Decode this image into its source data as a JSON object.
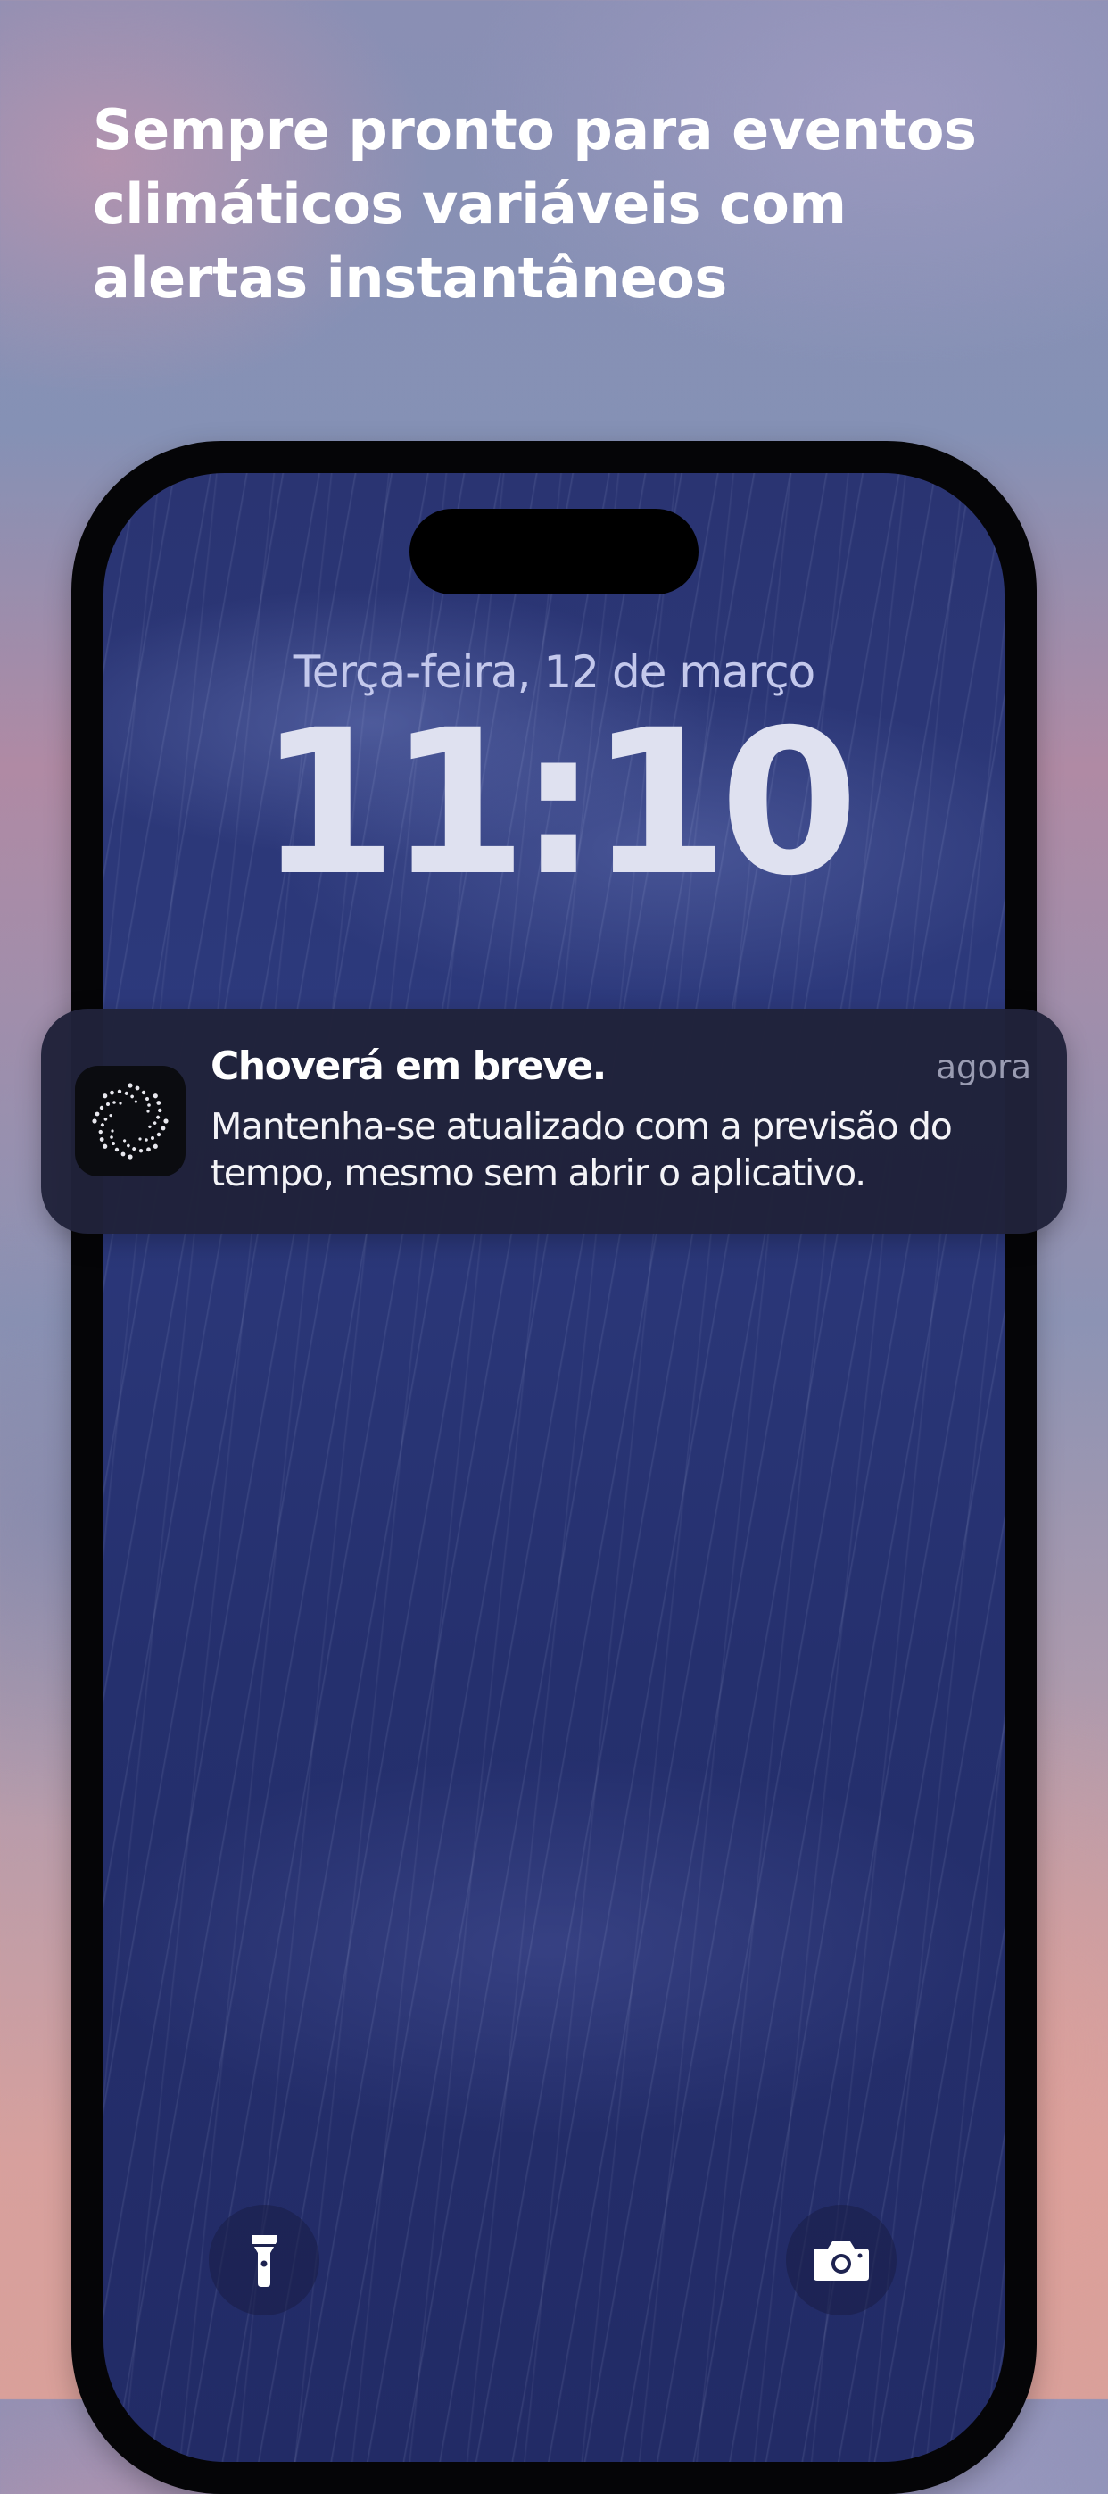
{
  "headline": "Sempre pronto para eventos climáticos variáveis com alertas instantâneos",
  "lock_screen": {
    "date": "Terça-feira, 12 de março",
    "time": "11:10",
    "flashlight_icon": "flashlight-icon",
    "camera_icon": "camera-icon"
  },
  "notification": {
    "app_icon": "weather-app-spiral-icon",
    "title": "Choverá em breve.",
    "time": "agora",
    "body": "Mantenha-se atualizado com a previsão do tempo, mesmo sem abrir o aplicativo."
  },
  "colors": {
    "wallpaper": "#2a3472",
    "notification_background": "#20223a",
    "date_text": "#c3c8ec",
    "time_text": "#dfe1f0",
    "notification_time_text": "#9a9cb2"
  }
}
